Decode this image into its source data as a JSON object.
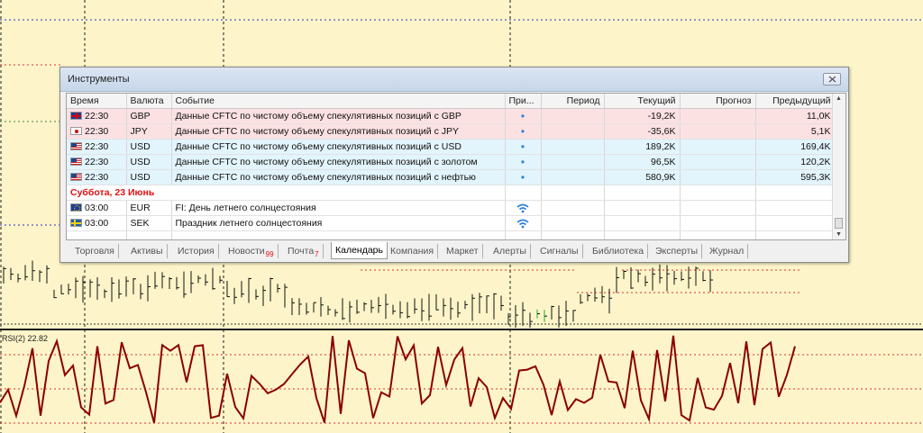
{
  "window": {
    "title": "Инструменты"
  },
  "indicator": {
    "label": "RSI(2) 22.82"
  },
  "columns": [
    "Время",
    "Валюта",
    "Событие",
    "При...",
    "Период",
    "Текущий",
    "Прогноз",
    "Предыдущий"
  ],
  "events": [
    {
      "flag": "gb",
      "time": "22:30",
      "currency": "GBP",
      "event": "Данные CFTC по чистому объему спекулятивных позиций с GBP",
      "priority": "•",
      "period": "",
      "current": "-19,2K",
      "forecast": "",
      "previous": "11,0K",
      "style": "pink"
    },
    {
      "flag": "jp",
      "time": "22:30",
      "currency": "JPY",
      "event": "Данные CFTC по чистому объему спекулятивных позиций с JPY",
      "priority": "•",
      "period": "",
      "current": "-35,6K",
      "forecast": "",
      "previous": "5,1K",
      "style": "pink"
    },
    {
      "flag": "us",
      "time": "22:30",
      "currency": "USD",
      "event": "Данные CFTC по чистому объему спекулятивных позиций с USD",
      "priority": "•",
      "period": "",
      "current": "189,2K",
      "forecast": "",
      "previous": "169,4K",
      "style": "blue"
    },
    {
      "flag": "us",
      "time": "22:30",
      "currency": "USD",
      "event": "Данные CFTC по чистому объему спекулятивных позиций с золотом",
      "priority": "•",
      "period": "",
      "current": "96,5K",
      "forecast": "",
      "previous": "120,2K",
      "style": "blue"
    },
    {
      "flag": "us",
      "time": "22:30",
      "currency": "USD",
      "event": "Данные CFTC по чистому объему спекулятивных позиций с нефтью",
      "priority": "•",
      "period": "",
      "current": "580,9K",
      "forecast": "",
      "previous": "595,3K",
      "style": "blue"
    }
  ],
  "date_row": "Суббота, 23 Июнь",
  "holidays": [
    {
      "flag": "eu",
      "time": "03:00",
      "currency": "EUR",
      "event": "FI: День летнего солнцестояния",
      "priority": "wifi-icon"
    },
    {
      "flag": "se",
      "time": "03:00",
      "currency": "SEK",
      "event": "Праздник летнего солнцестояния",
      "priority": "wifi-icon"
    }
  ],
  "tabs": [
    {
      "label": "Торговля"
    },
    {
      "label": "Активы"
    },
    {
      "label": "История"
    },
    {
      "label": "Новости",
      "badge": "99"
    },
    {
      "label": "Почта",
      "badge": "7"
    },
    {
      "label": "Календарь",
      "active": true
    },
    {
      "label": "Компания"
    },
    {
      "label": "Маркет"
    },
    {
      "label": "Алерты"
    },
    {
      "label": "Сигналы"
    },
    {
      "label": "Библиотека"
    },
    {
      "label": "Эксперты"
    },
    {
      "label": "Журнал"
    }
  ],
  "colors": {
    "chart_bg": "#fdf5c9",
    "rsi_line": "#8b0000",
    "level_red": "#e03030",
    "level_blue": "#3030c0",
    "level_green": "#3a8a3a"
  }
}
